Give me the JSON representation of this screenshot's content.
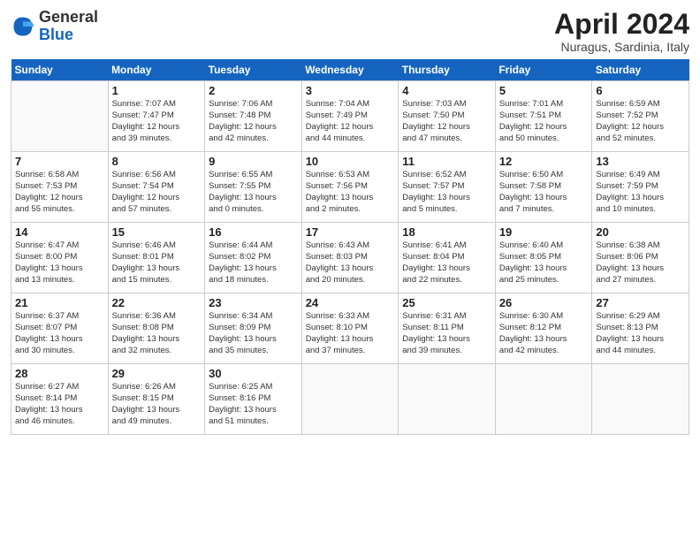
{
  "header": {
    "logo_general": "General",
    "logo_blue": "Blue",
    "title": "April 2024",
    "location": "Nuragus, Sardinia, Italy"
  },
  "days_of_week": [
    "Sunday",
    "Monday",
    "Tuesday",
    "Wednesday",
    "Thursday",
    "Friday",
    "Saturday"
  ],
  "weeks": [
    [
      {
        "day": "",
        "info": ""
      },
      {
        "day": "1",
        "info": "Sunrise: 7:07 AM\nSunset: 7:47 PM\nDaylight: 12 hours\nand 39 minutes."
      },
      {
        "day": "2",
        "info": "Sunrise: 7:06 AM\nSunset: 7:48 PM\nDaylight: 12 hours\nand 42 minutes."
      },
      {
        "day": "3",
        "info": "Sunrise: 7:04 AM\nSunset: 7:49 PM\nDaylight: 12 hours\nand 44 minutes."
      },
      {
        "day": "4",
        "info": "Sunrise: 7:03 AM\nSunset: 7:50 PM\nDaylight: 12 hours\nand 47 minutes."
      },
      {
        "day": "5",
        "info": "Sunrise: 7:01 AM\nSunset: 7:51 PM\nDaylight: 12 hours\nand 50 minutes."
      },
      {
        "day": "6",
        "info": "Sunrise: 6:59 AM\nSunset: 7:52 PM\nDaylight: 12 hours\nand 52 minutes."
      }
    ],
    [
      {
        "day": "7",
        "info": "Sunrise: 6:58 AM\nSunset: 7:53 PM\nDaylight: 12 hours\nand 55 minutes."
      },
      {
        "day": "8",
        "info": "Sunrise: 6:56 AM\nSunset: 7:54 PM\nDaylight: 12 hours\nand 57 minutes."
      },
      {
        "day": "9",
        "info": "Sunrise: 6:55 AM\nSunset: 7:55 PM\nDaylight: 13 hours\nand 0 minutes."
      },
      {
        "day": "10",
        "info": "Sunrise: 6:53 AM\nSunset: 7:56 PM\nDaylight: 13 hours\nand 2 minutes."
      },
      {
        "day": "11",
        "info": "Sunrise: 6:52 AM\nSunset: 7:57 PM\nDaylight: 13 hours\nand 5 minutes."
      },
      {
        "day": "12",
        "info": "Sunrise: 6:50 AM\nSunset: 7:58 PM\nDaylight: 13 hours\nand 7 minutes."
      },
      {
        "day": "13",
        "info": "Sunrise: 6:49 AM\nSunset: 7:59 PM\nDaylight: 13 hours\nand 10 minutes."
      }
    ],
    [
      {
        "day": "14",
        "info": "Sunrise: 6:47 AM\nSunset: 8:00 PM\nDaylight: 13 hours\nand 13 minutes."
      },
      {
        "day": "15",
        "info": "Sunrise: 6:46 AM\nSunset: 8:01 PM\nDaylight: 13 hours\nand 15 minutes."
      },
      {
        "day": "16",
        "info": "Sunrise: 6:44 AM\nSunset: 8:02 PM\nDaylight: 13 hours\nand 18 minutes."
      },
      {
        "day": "17",
        "info": "Sunrise: 6:43 AM\nSunset: 8:03 PM\nDaylight: 13 hours\nand 20 minutes."
      },
      {
        "day": "18",
        "info": "Sunrise: 6:41 AM\nSunset: 8:04 PM\nDaylight: 13 hours\nand 22 minutes."
      },
      {
        "day": "19",
        "info": "Sunrise: 6:40 AM\nSunset: 8:05 PM\nDaylight: 13 hours\nand 25 minutes."
      },
      {
        "day": "20",
        "info": "Sunrise: 6:38 AM\nSunset: 8:06 PM\nDaylight: 13 hours\nand 27 minutes."
      }
    ],
    [
      {
        "day": "21",
        "info": "Sunrise: 6:37 AM\nSunset: 8:07 PM\nDaylight: 13 hours\nand 30 minutes."
      },
      {
        "day": "22",
        "info": "Sunrise: 6:36 AM\nSunset: 8:08 PM\nDaylight: 13 hours\nand 32 minutes."
      },
      {
        "day": "23",
        "info": "Sunrise: 6:34 AM\nSunset: 8:09 PM\nDaylight: 13 hours\nand 35 minutes."
      },
      {
        "day": "24",
        "info": "Sunrise: 6:33 AM\nSunset: 8:10 PM\nDaylight: 13 hours\nand 37 minutes."
      },
      {
        "day": "25",
        "info": "Sunrise: 6:31 AM\nSunset: 8:11 PM\nDaylight: 13 hours\nand 39 minutes."
      },
      {
        "day": "26",
        "info": "Sunrise: 6:30 AM\nSunset: 8:12 PM\nDaylight: 13 hours\nand 42 minutes."
      },
      {
        "day": "27",
        "info": "Sunrise: 6:29 AM\nSunset: 8:13 PM\nDaylight: 13 hours\nand 44 minutes."
      }
    ],
    [
      {
        "day": "28",
        "info": "Sunrise: 6:27 AM\nSunset: 8:14 PM\nDaylight: 13 hours\nand 46 minutes."
      },
      {
        "day": "29",
        "info": "Sunrise: 6:26 AM\nSunset: 8:15 PM\nDaylight: 13 hours\nand 49 minutes."
      },
      {
        "day": "30",
        "info": "Sunrise: 6:25 AM\nSunset: 8:16 PM\nDaylight: 13 hours\nand 51 minutes."
      },
      {
        "day": "",
        "info": ""
      },
      {
        "day": "",
        "info": ""
      },
      {
        "day": "",
        "info": ""
      },
      {
        "day": "",
        "info": ""
      }
    ]
  ]
}
